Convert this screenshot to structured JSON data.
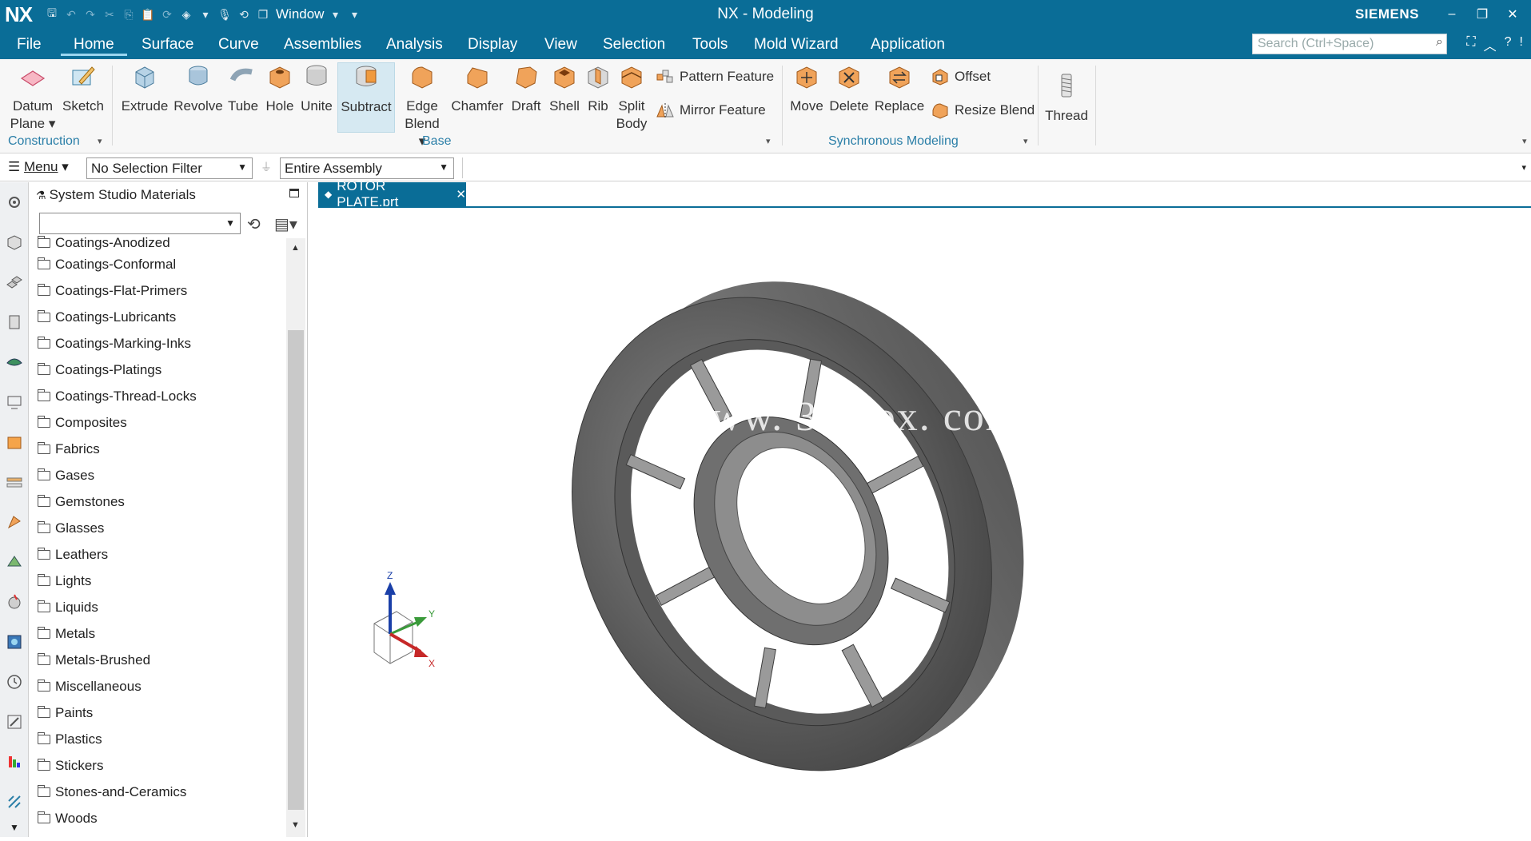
{
  "app": {
    "logo": "NX",
    "title": "NX - Modeling",
    "brand": "SIEMENS",
    "window_menu": "Window"
  },
  "tabs": [
    {
      "label": "File"
    },
    {
      "label": "Home",
      "active": true
    },
    {
      "label": "Surface"
    },
    {
      "label": "Curve"
    },
    {
      "label": "Assemblies"
    },
    {
      "label": "Analysis"
    },
    {
      "label": "Display"
    },
    {
      "label": "View"
    },
    {
      "label": "Selection"
    },
    {
      "label": "Tools"
    },
    {
      "label": "Mold Wizard"
    },
    {
      "label": "Application"
    }
  ],
  "search": {
    "placeholder": "Search (Ctrl+Space)"
  },
  "ribbon": {
    "construction": {
      "datum_plane": "Datum",
      "datum_plane_2": "Plane",
      "sketch": "Sketch",
      "group_label": "Construction"
    },
    "base": {
      "extrude": "Extrude",
      "revolve": "Revolve",
      "tube": "Tube",
      "hole": "Hole",
      "unite": "Unite",
      "subtract": "Subtract",
      "edge_blend": "Edge",
      "edge_blend_2": "Blend",
      "chamfer": "Chamfer",
      "draft": "Draft",
      "shell": "Shell",
      "rib": "Rib",
      "split_body": "Split",
      "split_body_2": "Body",
      "pattern_feature": "Pattern Feature",
      "mirror_feature": "Mirror Feature",
      "group_label": "Base"
    },
    "sync": {
      "move": "Move",
      "delete": "Delete",
      "replace": "Replace",
      "offset": "Offset",
      "resize_blend": "Resize Blend",
      "group_label": "Synchronous Modeling"
    },
    "thread": "Thread"
  },
  "selection_bar": {
    "menu": "Menu",
    "filter": "No Selection Filter",
    "scope": "Entire Assembly"
  },
  "panel": {
    "title": "System Studio Materials",
    "combo_value": "",
    "items": [
      "Coatings-Anodized",
      "Coatings-Conformal",
      "Coatings-Flat-Primers",
      "Coatings-Lubricants",
      "Coatings-Marking-Inks",
      "Coatings-Platings",
      "Coatings-Thread-Locks",
      "Composites",
      "Fabrics",
      "Gases",
      "Gemstones",
      "Glasses",
      "Leathers",
      "Lights",
      "Liquids",
      "Metals",
      "Metals-Brushed",
      "Miscellaneous",
      "Paints",
      "Plastics",
      "Stickers",
      "Stones-and-Ceramics",
      "Woods"
    ]
  },
  "document": {
    "tab_label": "ROTOR PLATE.prt"
  },
  "watermark": "www. 3dmox. com",
  "triad": {
    "z": "Z",
    "y": "Y",
    "x": "X"
  },
  "colors": {
    "accent": "#0a6d97",
    "part": "#6b6b6b"
  }
}
